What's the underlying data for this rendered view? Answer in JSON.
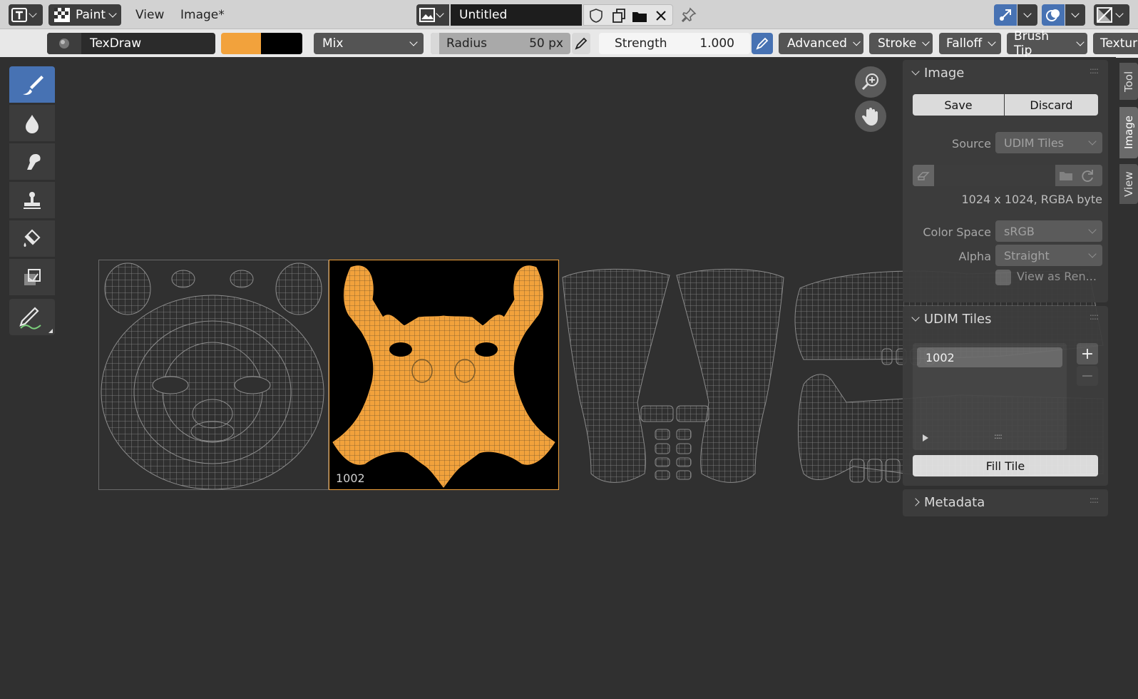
{
  "header": {
    "mode_label": "Paint",
    "menus": [
      "View",
      "Image*"
    ],
    "image_name": "Untitled"
  },
  "tool_header": {
    "brush_name": "TexDraw",
    "primary_color": "#f2a23c",
    "secondary_color": "#000000",
    "blend_mode": "Mix",
    "radius_label": "Radius",
    "radius_value": "50 px",
    "strength_label": "Strength",
    "strength_value": "1.000",
    "popovers": [
      "Advanced",
      "Stroke",
      "Falloff",
      "Brush Tip",
      "Textur"
    ]
  },
  "toolbar": {
    "tools": [
      "draw-brush-icon",
      "soften-drop-icon",
      "smear-icon",
      "clone-stamp-icon",
      "fill-bucket-icon",
      "mask-icon"
    ],
    "annotate_tool": "annotate-pen-icon",
    "active_index": 0
  },
  "viewport": {
    "active_tile_label": "1002",
    "accent_color": "#f2a23c"
  },
  "image_panel": {
    "title": "Image",
    "save_label": "Save",
    "discard_label": "Discard",
    "source_label": "Source",
    "source_value": "UDIM Tiles",
    "info": "1024 x 1024,  RGBA byte",
    "color_space_label": "Color Space",
    "color_space_value": "sRGB",
    "alpha_label": "Alpha",
    "alpha_value": "Straight",
    "view_as_render_label": "View as Ren..."
  },
  "udim_panel": {
    "title": "UDIM Tiles",
    "tiles": [
      "1002"
    ],
    "fill_tile_label": "Fill Tile"
  },
  "metadata_panel": {
    "title": "Metadata"
  },
  "side_tabs": [
    "Tool",
    "Image",
    "View"
  ]
}
